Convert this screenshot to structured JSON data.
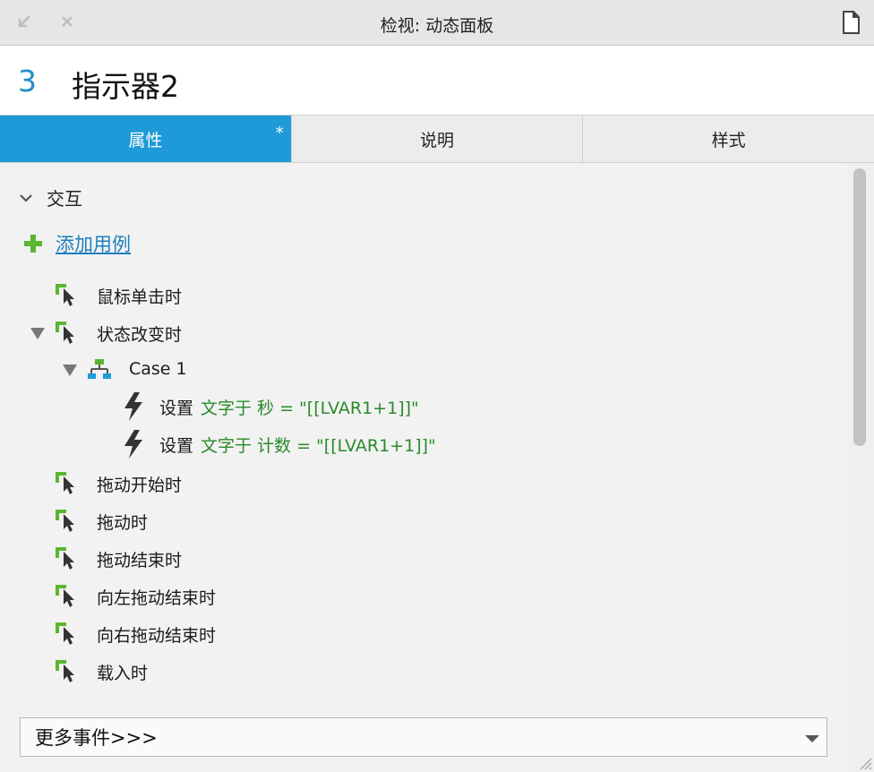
{
  "window": {
    "title": "检视: 动态面板",
    "collapse_icon": "arrow-down-left-icon",
    "close_icon": "close-icon",
    "page_icon": "document-icon"
  },
  "header": {
    "number": "3",
    "name": "指示器2"
  },
  "tabs": [
    {
      "label": "属性",
      "active": true,
      "modified_marker": "*"
    },
    {
      "label": "说明",
      "active": false
    },
    {
      "label": "样式",
      "active": false
    }
  ],
  "interactions": {
    "section_title": "交互",
    "add_case_label": "添加用例",
    "events": [
      {
        "label": "鼠标单击时"
      },
      {
        "label": "状态改变时"
      },
      {
        "label": "拖动开始时"
      },
      {
        "label": "拖动时"
      },
      {
        "label": "拖动结束时"
      },
      {
        "label": "向左拖动结束时"
      },
      {
        "label": "向右拖动结束时"
      },
      {
        "label": "载入时"
      }
    ],
    "case": {
      "label": "Case 1",
      "actions": [
        {
          "verb": "设置",
          "detail": "文字于 秒 = \"[[LVAR1+1]]\""
        },
        {
          "verb": "设置",
          "detail": "文字于 计数 = \"[[LVAR1+1]]\""
        }
      ]
    },
    "more_events_label": "更多事件>>>"
  },
  "colors": {
    "accent_blue": "#1f9ad8",
    "link_blue": "#1d7fbf",
    "action_green": "#2a8a2a",
    "icon_green": "#5bb531"
  }
}
